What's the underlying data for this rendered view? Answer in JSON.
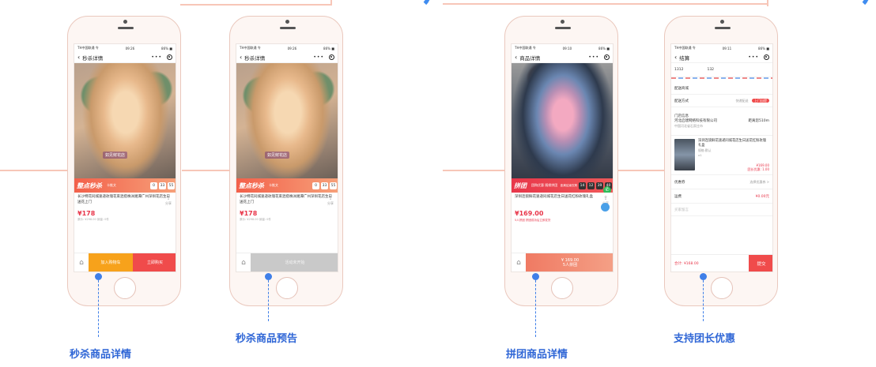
{
  "colors": {
    "accent_blue": "#3f7fe8",
    "promo_orange": "#f3604a",
    "promo_red": "#e8364a",
    "button_orange": "#f7a21b",
    "button_red": "#f04b4b",
    "deco_pink": "#f7c6b8"
  },
  "phones": [
    {
      "status": {
        "carrier": "TH中国联通 令",
        "time": "09:26",
        "battery": "86% ■"
      },
      "nav_title": "秒杀详情",
      "shop_tag": "如见鲜花店",
      "promo": {
        "title": "整点秒杀",
        "sub": "卡推文",
        "countdown": [
          "0",
          "33",
          "55"
        ]
      },
      "description": "长沙特花同城速递玫瑰花束混搭株洲湘潭广州深圳花店生日送花上门",
      "share_label": "分享",
      "price": "¥178",
      "sold": "原价: ¥298.00  销量: 0件",
      "buttons": [
        "加入购物车",
        "立即购买"
      ]
    },
    {
      "status": {
        "carrier": "TH中国联通 令",
        "time": "09:26",
        "battery": "86% ■"
      },
      "nav_title": "秒杀详情",
      "shop_tag": "如见鲜花店",
      "promo": {
        "title": "整点秒杀",
        "sub": "卡推文",
        "countdown": [
          "0",
          "33",
          "55"
        ]
      },
      "description": "长沙特花同城速递玫瑰花束混搭株洲湘潭广州深圳花店生日送花上门",
      "share_label": "分享",
      "price": "¥178",
      "sold": "原价: ¥298.00  销量: 0件",
      "buttons": [
        "活动未开始"
      ]
    },
    {
      "status": {
        "carrier": "TH中国联通 令",
        "time": "09:10",
        "battery": "86% ■"
      },
      "nav_title": "商品详情",
      "promo": {
        "title": "拼团",
        "sub": "团购优惠 随缘拼团",
        "countdown_label": "距离结束仅剩",
        "countdown": [
          "14",
          "12",
          "39",
          "40"
        ]
      },
      "description": "深圳连锁鲜花速递同城花店生日送花红粉玫瑰礼盒",
      "share_label": "分享",
      "price": "¥169.00",
      "group_tip": "5人拼团  拼团成功后立即发货",
      "buttons": [
        "¥ 169.00\n5人拼团"
      ]
    },
    {
      "status": {
        "carrier": "TH中国联通 令",
        "time": "09:11",
        "battery": "86% ■"
      },
      "nav_title": "结算",
      "address": {
        "name": "1312",
        "phone": "132"
      },
      "section_title": "配送商城",
      "delivery": {
        "label": "配送方式",
        "option_a": "快递配送",
        "option_b": "上门自提"
      },
      "store": {
        "label": "门店信息",
        "name": "河北启建网络科技有限公司",
        "distance": "距离您510m",
        "address": "中国河北省石家庄市"
      },
      "goods": {
        "title": "深圳连锁鲜花速递同城花店生日送花红粉玫瑰礼盒",
        "spec": "规格:默认",
        "qty": "x1",
        "price": "¥169.00",
        "discount": "团长优惠: 1.00"
      },
      "coupon": {
        "label": "优惠券",
        "value": "选择优惠券 >"
      },
      "freight": {
        "label": "运费",
        "value": "¥0.00元"
      },
      "remark": "买家留言",
      "total": "合计: ¥168.00",
      "submit": "提交"
    }
  ],
  "captions": [
    "秒杀商品详情",
    "秒杀商品预告",
    "拼团商品详情",
    "支持团长优惠"
  ]
}
